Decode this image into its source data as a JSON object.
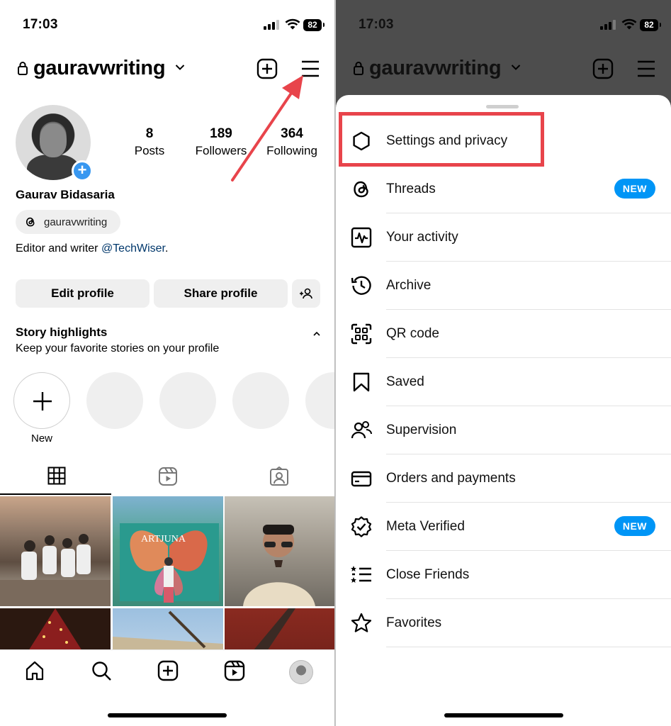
{
  "status_bar": {
    "time": "17:03",
    "battery": "82"
  },
  "profile_screen": {
    "username": "gauravwriting",
    "stats": [
      {
        "value": "8",
        "label": "Posts"
      },
      {
        "value": "189",
        "label": "Followers"
      },
      {
        "value": "364",
        "label": "Following"
      }
    ],
    "name": "Gaurav Bidasaria",
    "threads_handle": "gauravwriting",
    "bio_text": "Editor and writer ",
    "bio_link": "@TechWiser",
    "bio_end": ".",
    "edit_profile": "Edit profile",
    "share_profile": "Share profile",
    "story_highlights_title": "Story highlights",
    "story_highlights_subtitle": "Keep your favorite stories on your profile",
    "new_highlight_label": "New",
    "grid_photo_text": [
      "ARTJUNA"
    ]
  },
  "menu_sheet": {
    "username": "gauravwriting",
    "items": [
      {
        "label": "Settings and privacy",
        "icon": "settings-icon"
      },
      {
        "label": "Threads",
        "icon": "threads-icon",
        "badge": "NEW"
      },
      {
        "label": "Your activity",
        "icon": "activity-icon"
      },
      {
        "label": "Archive",
        "icon": "archive-icon"
      },
      {
        "label": "QR code",
        "icon": "qr-code-icon"
      },
      {
        "label": "Saved",
        "icon": "bookmark-icon"
      },
      {
        "label": "Supervision",
        "icon": "supervision-icon"
      },
      {
        "label": "Orders and payments",
        "icon": "card-icon"
      },
      {
        "label": "Meta Verified",
        "icon": "verified-icon",
        "badge": "NEW"
      },
      {
        "label": "Close Friends",
        "icon": "close-friends-icon"
      },
      {
        "label": "Favorites",
        "icon": "star-icon"
      }
    ]
  },
  "colors": {
    "accent_blue": "#0095f6",
    "highlight_red": "#e8444b",
    "link_blue": "#00376b"
  }
}
